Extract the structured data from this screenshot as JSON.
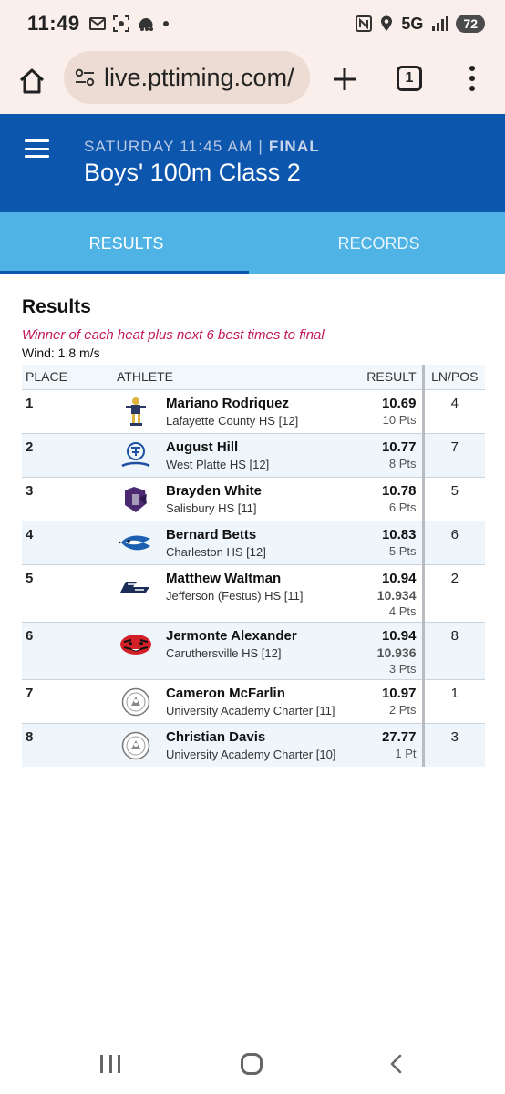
{
  "status_bar": {
    "time": "11:49",
    "network": "5G",
    "battery": "72",
    "icons": [
      "mail-icon",
      "screenshot-icon",
      "gallery-icon",
      "dot-icon",
      "nfc-icon",
      "location-icon",
      "signal-icon",
      "battery-icon"
    ]
  },
  "browser": {
    "url": "live.pttiming.com/",
    "tab_count": "1"
  },
  "header": {
    "subtitle_prefix": "SATURDAY 11:45 AM | ",
    "subtitle_status": "FINAL",
    "title": "Boys' 100m Class 2"
  },
  "tabs": [
    {
      "label": "RESULTS",
      "active": true
    },
    {
      "label": "RECORDS",
      "active": false
    }
  ],
  "results": {
    "heading": "Results",
    "note": "Winner of each heat plus next 6 best times to final",
    "wind": "Wind: 1.8 m/s",
    "columns": {
      "place": "PLACE",
      "athlete": "ATHLETE",
      "result": "RESULT",
      "lane": "LN/POS"
    },
    "rows": [
      {
        "place": "1",
        "name": "Mariano Rodriquez",
        "school": "Lafayette County HS [12]",
        "result": "10.69",
        "precise": "",
        "points": "10 Pts",
        "lane": "4",
        "logo": "lafayette-logo-icon"
      },
      {
        "place": "2",
        "name": "August Hill",
        "school": "West Platte HS [12]",
        "result": "10.77",
        "precise": "",
        "points": "8 Pts",
        "lane": "7",
        "logo": "bluejays-logo-icon"
      },
      {
        "place": "3",
        "name": "Brayden White",
        "school": "Salisbury HS [11]",
        "result": "10.78",
        "precise": "",
        "points": "6 Pts",
        "lane": "5",
        "logo": "salisbury-logo-icon"
      },
      {
        "place": "4",
        "name": "Bernard Betts",
        "school": "Charleston HS [12]",
        "result": "10.83",
        "precise": "",
        "points": "5 Pts",
        "lane": "6",
        "logo": "charleston-logo-icon"
      },
      {
        "place": "5",
        "name": "Matthew Waltman",
        "school": "Jefferson (Festus) HS [11]",
        "result": "10.94",
        "precise": "10.934",
        "points": "4 Pts",
        "lane": "2",
        "logo": "jefferson-logo-icon"
      },
      {
        "place": "6",
        "name": "Jermonte Alexander",
        "school": "Caruthersville HS [12]",
        "result": "10.94",
        "precise": "10.936",
        "points": "3 Pts",
        "lane": "8",
        "logo": "caruthersville-logo-icon"
      },
      {
        "place": "7",
        "name": "Cameron McFarlin",
        "school": "University Academy Charter [11]",
        "result": "10.97",
        "precise": "",
        "points": "2 Pts",
        "lane": "1",
        "logo": "university-academy-logo-icon"
      },
      {
        "place": "8",
        "name": "Christian Davis",
        "school": "University Academy Charter [10]",
        "result": "27.77",
        "precise": "",
        "points": "1 Pt",
        "lane": "3",
        "logo": "university-academy-logo-icon"
      }
    ]
  },
  "colors": {
    "header_blue": "#0d56ad",
    "tab_bar_blue": "#4fb4e5",
    "note_pink": "#c2185b",
    "browser_bg": "#fbefec"
  }
}
